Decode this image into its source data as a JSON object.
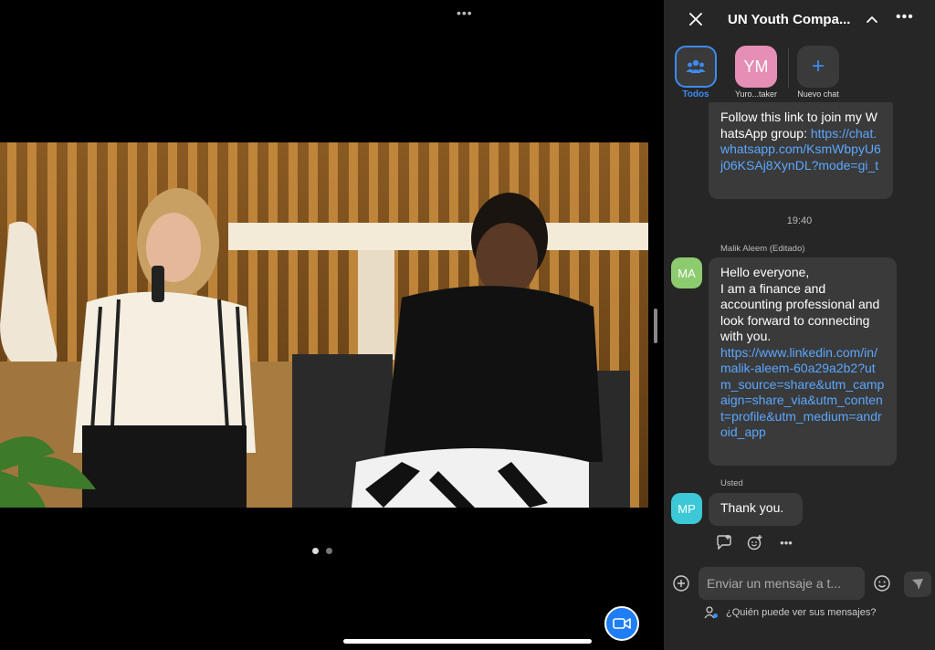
{
  "video": {
    "top_menu": "•••",
    "page_dots": 2,
    "active_page": 1
  },
  "chat": {
    "title": "UN Youth Compa...",
    "tabs": [
      {
        "label": "Todos",
        "icon": "group-icon"
      },
      {
        "initials": "YM",
        "label": "Yuro...taker"
      },
      {
        "label": "Nuevo chat",
        "icon": "plus-icon"
      }
    ],
    "messages": {
      "prev_text": "Follow this link to join my WhatsApp group: ",
      "prev_link": "https://chat.whatsapp.com/KsmWbpyU6j06KSAj8XynDL?mode=gi_t",
      "time": "19:40",
      "malik_sender": "Malik Aleem",
      "malik_edited": "(Editado)",
      "malik_initials": "MA",
      "malik_text": "Hello everyone,\nI am a finance and accounting professional and look forward to connecting with you.",
      "malik_link": "https://www.linkedin.com/in/malik-aleem-60a29a2b2?utm_source=share&utm_campaign=share_via&utm_content=profile&utm_medium=android_app",
      "mine_sender": "Usted",
      "mine_initials": "MP",
      "mine_text": "Thank you."
    },
    "composer": {
      "placeholder": "Enviar un mensaje a t..."
    },
    "visibility_text": "¿Quién puede ver sus mensajes?"
  },
  "colors": {
    "accent": "#3d8bf2",
    "link": "#5aa7ff",
    "panel_bg": "#262626",
    "bubble_bg": "#3a3a3a",
    "avatar_ym": "#e58fb6",
    "avatar_ma": "#8ccc6e",
    "avatar_mp": "#3cc8d6"
  }
}
